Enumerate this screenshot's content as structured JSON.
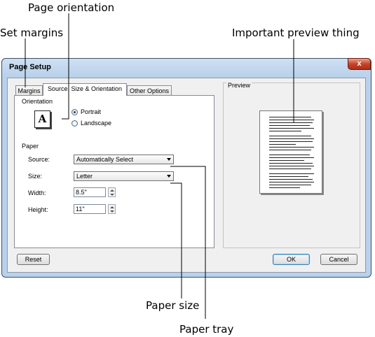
{
  "callouts": {
    "page_orientation": "Page orientation",
    "set_margins": "Set margins",
    "important_preview": "Important preview thing",
    "paper_size": "Paper size",
    "paper_tray": "Paper tray"
  },
  "dialog": {
    "title": "Page Setup",
    "close": "x",
    "tabs": [
      {
        "label": "Margins"
      },
      {
        "label": "Source, Size & Orientation",
        "selected": true
      },
      {
        "label": "Other Options"
      }
    ],
    "orientation": {
      "group_label": "Orientation",
      "icon_letter": "A",
      "options": [
        {
          "label": "Portrait",
          "checked": true
        },
        {
          "label": "Landscape",
          "checked": false
        }
      ]
    },
    "paper": {
      "group_label": "Paper",
      "source_label": "Source:",
      "source_value": "Automatically Select",
      "size_label": "Size:",
      "size_value": "Letter",
      "width_label": "Width:",
      "width_value": "8.5\"",
      "height_label": "Height:",
      "height_value": "11\""
    },
    "preview_label": "Preview",
    "buttons": {
      "reset": "Reset",
      "ok": "OK",
      "cancel": "Cancel"
    }
  }
}
